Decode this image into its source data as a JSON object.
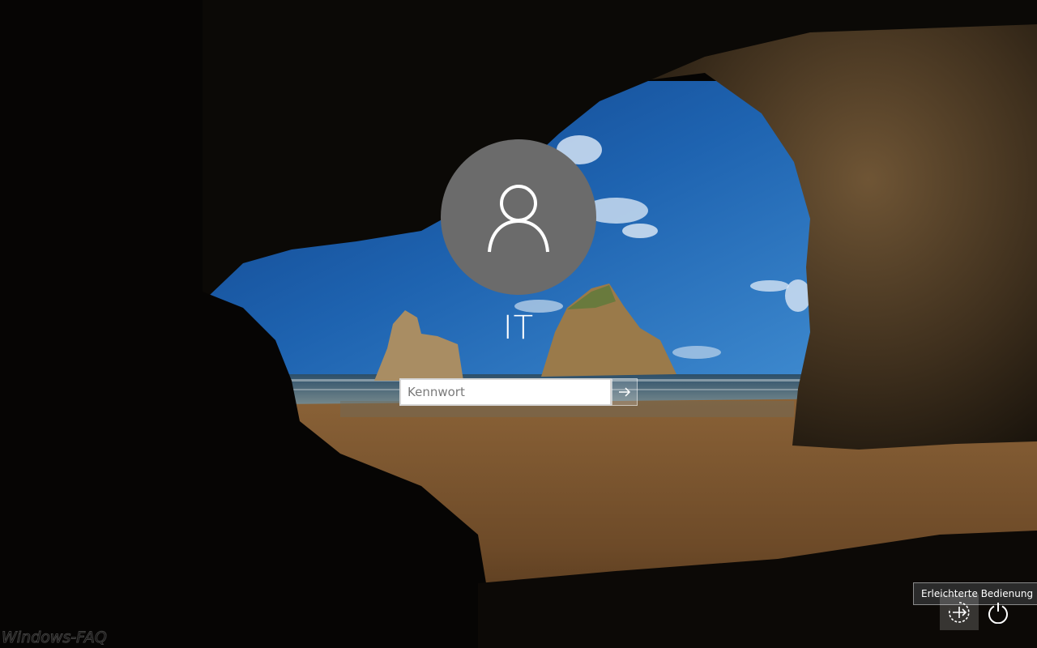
{
  "user": {
    "name": "IT"
  },
  "password": {
    "placeholder": "Kennwort",
    "value": ""
  },
  "icons": {
    "avatar": "user-silhouette-icon",
    "submit": "arrow-right-icon",
    "ease_of_access": "ease-of-access-icon",
    "power": "power-icon"
  },
  "tooltip": {
    "text": "Erleichterte Bedienung"
  },
  "watermark": {
    "text": "Windows-FAQ"
  },
  "colors": {
    "avatar_bg": "#6b6b6b",
    "input_bg": "#ffffff",
    "tooltip_bg": "#2b2b2b",
    "sky": "#1d5fa8",
    "sand": "#7a5430"
  }
}
